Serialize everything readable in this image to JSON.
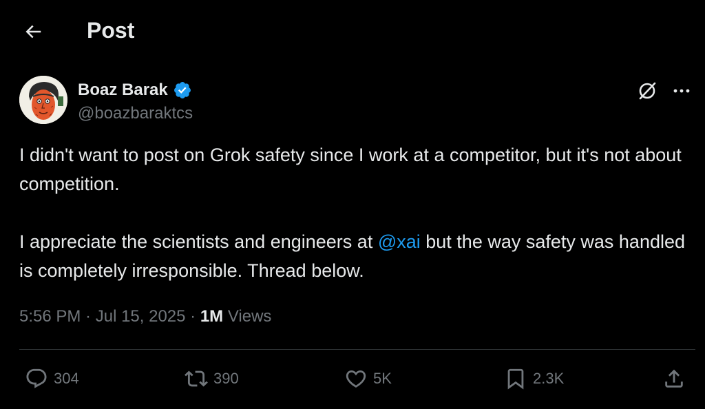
{
  "header": {
    "title": "Post",
    "back_icon": "arrow-left-icon"
  },
  "author": {
    "name": "Boaz Barak",
    "handle": "@boazbaraktcs",
    "verified": true,
    "avatar_icon": "avatar-drawing"
  },
  "tweet": {
    "paragraph1": "I didn't want to post on Grok safety since I work at a competitor, but it's not about competition.",
    "paragraph2_before": "I appreciate the scientists and engineers at ",
    "mention": "@xai",
    "paragraph2_after": " but the way safety was handled is completely irresponsible. Thread below."
  },
  "meta": {
    "time": "5:56 PM",
    "separator1": " · ",
    "date": "Jul 15, 2025",
    "separator2": " · ",
    "views_count": "1M",
    "views_label": " Views"
  },
  "actions": {
    "replies": "304",
    "reposts": "390",
    "likes": "5K",
    "bookmarks": "2.3K"
  },
  "colors": {
    "background": "#000000",
    "text": "#e7e9ea",
    "muted": "#71767b",
    "accent": "#1d9bf0",
    "divider": "#2f3336"
  }
}
